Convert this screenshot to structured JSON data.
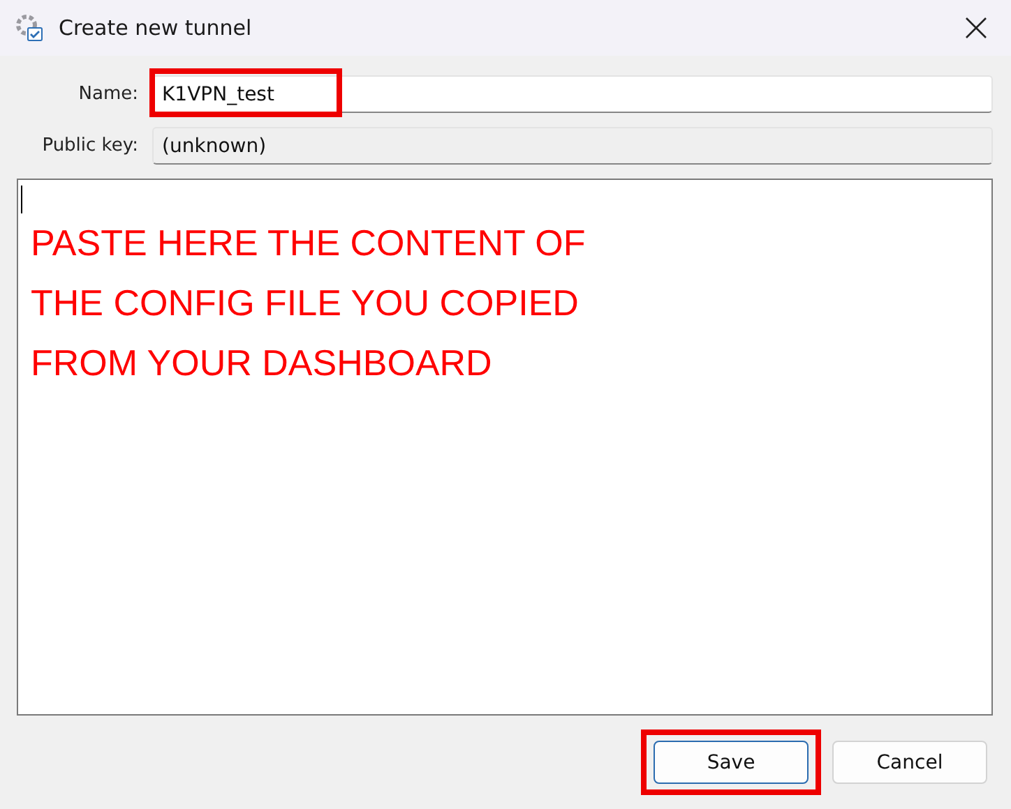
{
  "window": {
    "title": "Create new tunnel"
  },
  "fields": [
    {
      "label": "Name:",
      "value": "K1VPN_test",
      "readonly": false,
      "highlighted": true
    },
    {
      "label": "Public key:",
      "value": "(unknown)",
      "readonly": true,
      "highlighted": false
    }
  ],
  "editor": {
    "annotation": "PASTE HERE THE CONTENT OF\nTHE CONFIG FILE YOU COPIED\nFROM YOUR DASHBOARD"
  },
  "buttons": [
    {
      "label": "Save",
      "highlighted": true
    },
    {
      "label": "Cancel",
      "highlighted": false
    }
  ]
}
